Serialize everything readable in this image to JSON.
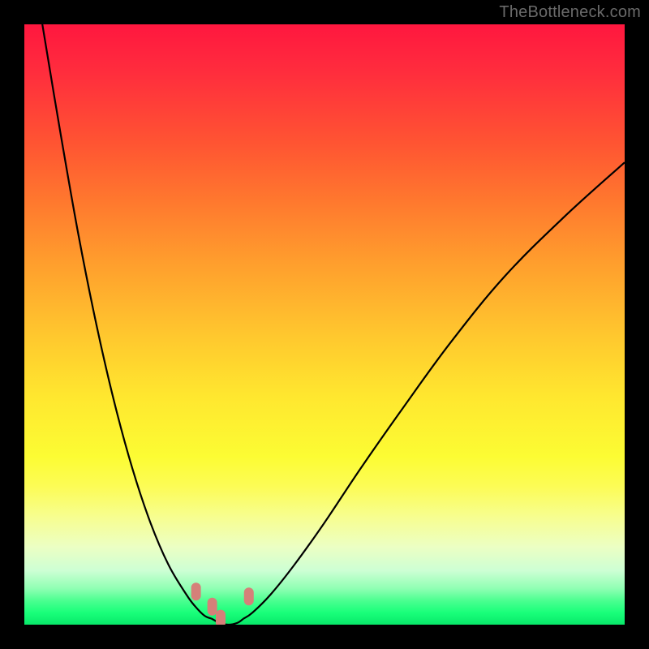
{
  "watermark": "TheBottleneck.com",
  "colors": {
    "frame": "#000000",
    "curve": "#000000",
    "marker": "#d58079",
    "gradient_top": "#ff173f",
    "gradient_bottom": "#08e869"
  },
  "chart_data": {
    "type": "line",
    "title": "",
    "xlabel": "",
    "ylabel": "",
    "xlim": [
      0,
      100
    ],
    "ylim": [
      0,
      100
    ],
    "note": "Values estimated from pixels; x and y are 0-100 normalized to the colored plot area. y=0 is the bottom (green) edge.",
    "series": [
      {
        "name": "left-branch",
        "x": [
          3,
          6,
          9,
          12,
          15,
          18,
          21,
          24,
          27,
          28.5,
          30,
          31.2
        ],
        "y": [
          100,
          82,
          65,
          50,
          37,
          26,
          17,
          10,
          5,
          3,
          1.5,
          1
        ]
      },
      {
        "name": "right-branch",
        "x": [
          36.5,
          38,
          41,
          45,
          50,
          56,
          63,
          71,
          80,
          90,
          100
        ],
        "y": [
          1,
          2,
          5,
          10,
          17,
          26,
          36,
          47,
          58,
          68,
          77
        ]
      },
      {
        "name": "valley-floor",
        "x": [
          31.2,
          32.5,
          34,
          35.5,
          36.5
        ],
        "y": [
          1,
          0.3,
          0,
          0.3,
          1
        ]
      }
    ],
    "markers": [
      {
        "name": "left-upper",
        "x": 28.6,
        "y": 5.5
      },
      {
        "name": "left-lower",
        "x": 31.3,
        "y": 3.0
      },
      {
        "name": "valley-left",
        "x": 32.7,
        "y": 1.0
      },
      {
        "name": "right-lower",
        "x": 37.4,
        "y": 4.7
      }
    ]
  }
}
